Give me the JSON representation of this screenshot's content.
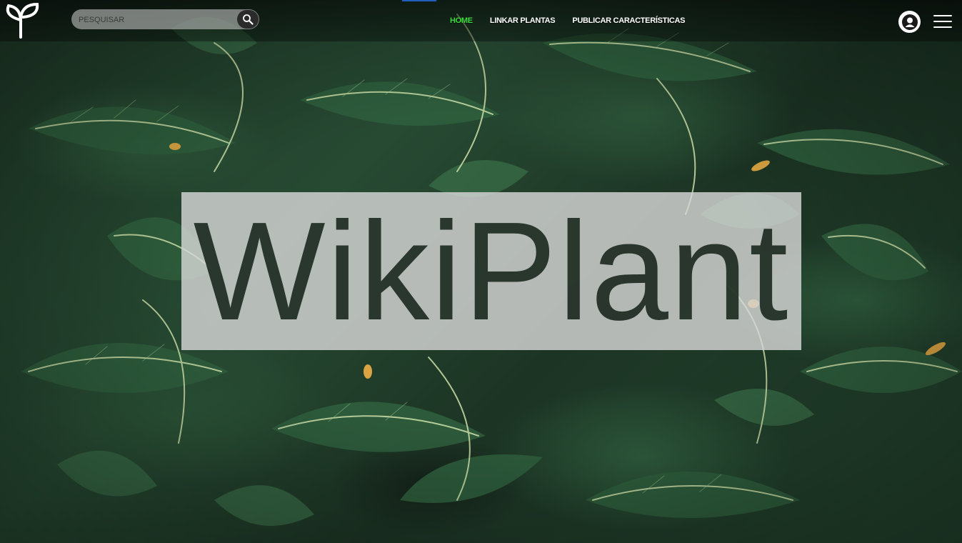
{
  "header": {
    "logo_icon": "sprout-icon",
    "search": {
      "placeholder": "PESQUISAR",
      "value": "",
      "icon": "search-icon"
    },
    "nav": [
      {
        "label": "HOME",
        "active": true
      },
      {
        "label": "LINKAR PLANTAS",
        "active": false
      },
      {
        "label": "PUBLICAR CARACTERÍSTICAS",
        "active": false
      }
    ],
    "user_icon": "user-icon",
    "menu_icon": "hamburger-menu-icon"
  },
  "hero": {
    "title": "WikiPlant",
    "background": "dark-green-foliage-photo"
  },
  "colors": {
    "nav_active": "#3ddc3d",
    "nav_text": "#ffffff",
    "title_box": "#d7d7d7",
    "title_text": "#17251b",
    "indicator": "#1e5fbf"
  }
}
